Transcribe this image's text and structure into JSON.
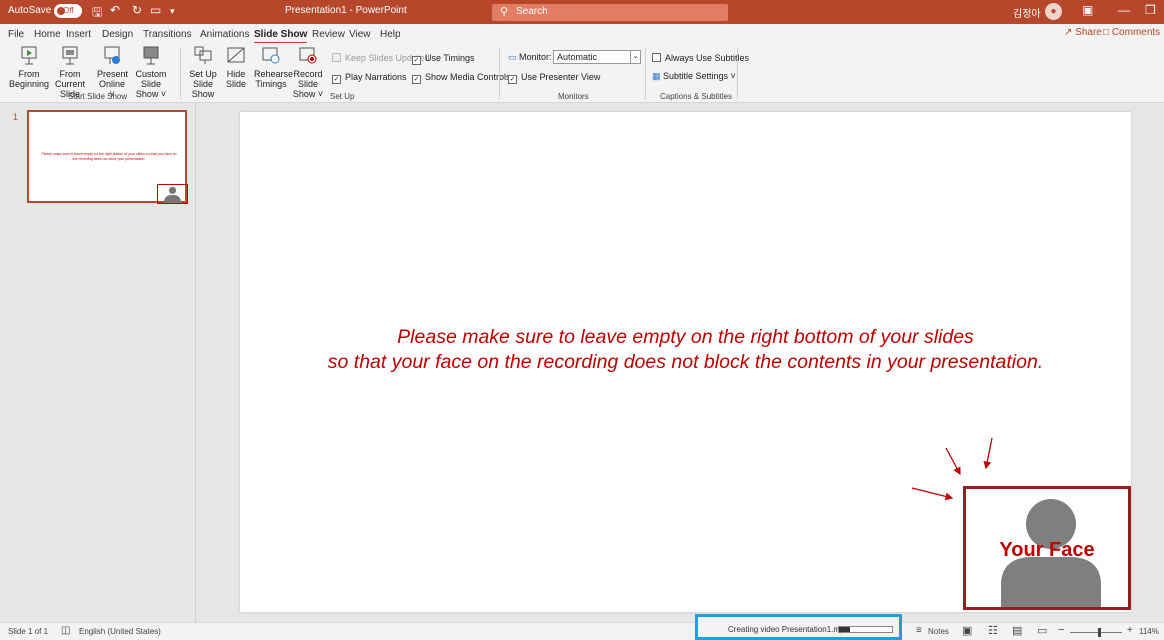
{
  "titlebar": {
    "autosave": "AutoSave",
    "autosave_state": "Off",
    "doc_title": "Presentation1 - PowerPoint",
    "search_placeholder": "Search",
    "user_name": "김정아"
  },
  "menu": {
    "tabs": [
      "File",
      "Home",
      "Insert",
      "Design",
      "Transitions",
      "Animations",
      "Slide Show",
      "Review",
      "View",
      "Help"
    ],
    "active": "Slide Show",
    "share": "Share",
    "comments": "Comments"
  },
  "ribbon": {
    "start_slide_show": {
      "label": "Start Slide Show",
      "from_beginning": [
        "From",
        "Beginning"
      ],
      "from_current": [
        "From",
        "Current Slide"
      ],
      "present_online": [
        "Present",
        "Online ˅"
      ],
      "custom_slide_show": [
        "Custom Slide",
        "Show ˅"
      ]
    },
    "set_up": {
      "label": "Set Up",
      "set_up_slide_show": [
        "Set Up",
        "Slide Show"
      ],
      "hide_slide": [
        "Hide",
        "Slide"
      ],
      "rehearse_timings": [
        "Rehearse",
        "Timings"
      ],
      "record_slide_show": [
        "Record Slide",
        "Show ˅"
      ],
      "keep_slides_updated": "Keep Slides Updated",
      "play_narrations": "Play Narrations",
      "use_timings": "Use Timings",
      "show_media_controls": "Show Media Controls"
    },
    "monitors": {
      "label": "Monitors",
      "monitor_label": "Monitor:",
      "monitor_value": "Automatic",
      "use_presenter_view": "Use Presenter View"
    },
    "captions": {
      "label": "Captions & Subtitles",
      "always_use_subtitles": "Always Use Subtitles",
      "subtitle_settings": "Subtitle Settings ˅"
    }
  },
  "thumbnails": {
    "number": "1",
    "text": "Please make sure to leave empty on the right bottom of your slides so that your face on the recording does not block your presentation."
  },
  "slide": {
    "line1": "Please make sure to leave empty on the right bottom of your slides",
    "line2": "so that your face on the recording does not block the contents in your presentation.",
    "face_label": "Your Face"
  },
  "status": {
    "slide_count": "Slide 1 of 1",
    "language": "English (United States)",
    "creating_video": "Creating video Presentation1.mp4",
    "progress": 0.2,
    "notes": "Notes",
    "zoom": "114%"
  },
  "colors": {
    "accent": "#b7472a",
    "slide_text": "#c00000",
    "face_border": "#9b1c1c",
    "highlight_frame": "#1aa0e6"
  }
}
